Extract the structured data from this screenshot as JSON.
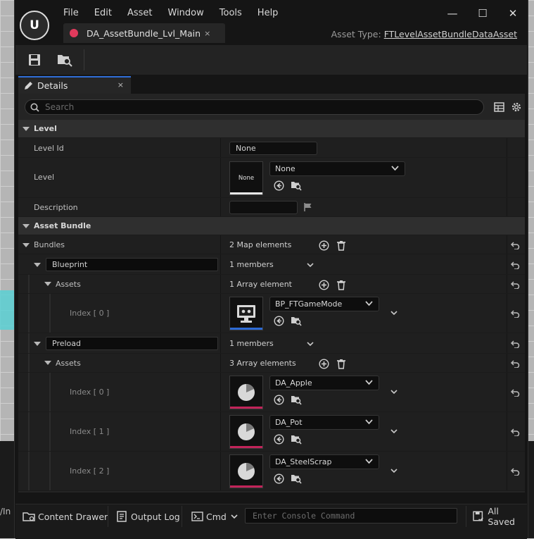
{
  "background": {
    "partial_text": "/In"
  },
  "window": {
    "menu": [
      "File",
      "Edit",
      "Asset",
      "Window",
      "Tools",
      "Help"
    ],
    "document_tab": {
      "label": "DA_AssetBundle_Lvl_Main",
      "close": "×"
    },
    "asset_type": {
      "label": "Asset Type:",
      "value": "FTLevelAssetBundleDataAsset"
    },
    "controls": {
      "minimize": "—",
      "maximize": "☐",
      "close": "✕"
    }
  },
  "details_tab": {
    "label": "Details",
    "close": "×"
  },
  "search": {
    "placeholder": "Search"
  },
  "level_section": {
    "title": "Level",
    "level_id": {
      "label": "Level Id",
      "value": "None"
    },
    "level": {
      "label": "Level",
      "thumb_text": "None",
      "dropdown": "None"
    },
    "description": {
      "label": "Description",
      "value": ""
    }
  },
  "asset_bundle_section": {
    "title": "Asset Bundle",
    "bundles": {
      "label": "Bundles",
      "value": "2 Map elements"
    },
    "groups": [
      {
        "key": "Blueprint",
        "members": "1 members",
        "assets_label": "Assets",
        "assets_count": "1 Array element",
        "items": [
          {
            "index": "Index [ 0 ]",
            "value": "BP_FTGameMode",
            "thumb": "gamemode-thumbnail",
            "accent": "#2d6bd6"
          }
        ]
      },
      {
        "key": "Preload",
        "members": "1 members",
        "assets_label": "Assets",
        "assets_count": "3 Array elements",
        "items": [
          {
            "index": "Index [ 0 ]",
            "value": "DA_Apple",
            "thumb": "data-asset-thumbnail",
            "accent": "#c2245a"
          },
          {
            "index": "Index [ 1 ]",
            "value": "DA_Pot",
            "thumb": "data-asset-thumbnail",
            "accent": "#c2245a"
          },
          {
            "index": "Index [ 2 ]",
            "value": "DA_SteelScrap",
            "thumb": "data-asset-thumbnail",
            "accent": "#c2245a"
          }
        ]
      }
    ]
  },
  "statusbar": {
    "content_drawer": "Content Drawer",
    "output_log": "Output Log",
    "cmd": "Cmd",
    "console_placeholder": "Enter Console Command",
    "saved": "All Saved"
  },
  "colors": {
    "accent_blue": "#2f6ed8",
    "doc_tab_dot": "#e03a5c",
    "data_asset_accent": "#c2245a",
    "blueprint_accent": "#2d6bd6"
  }
}
